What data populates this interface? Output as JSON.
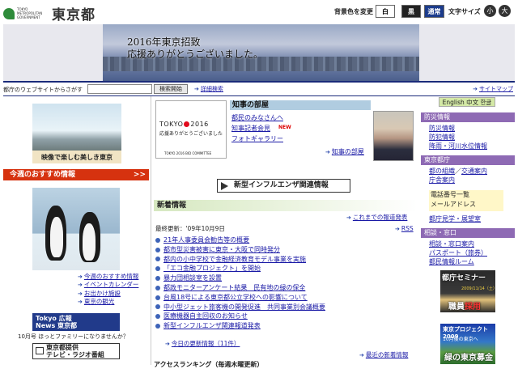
{
  "header": {
    "logo_small": "TOKYO METROPOLITAN GOVERNMENT",
    "logo_big": "東京都",
    "bg_color_label": "背景色を変更",
    "bg_white": "白",
    "bg_black": "黒",
    "bg_normal": "通常",
    "font_size_label": "文字サイズ",
    "font_small": "小",
    "font_large": "大"
  },
  "banner": {
    "line1": "2016年東京招致",
    "line2": "応援ありがとうございました。"
  },
  "search": {
    "label": "都庁のウェブサイトからさがす",
    "placeholder": "",
    "button": "検索開始",
    "advanced": "詳細検索",
    "sitemap": "サイトマップ"
  },
  "left": {
    "video_caption": "映像で楽しむ美しき東京",
    "recommend_title": "今週のおすすめ情報",
    "links": [
      "今週のおすすめ情報",
      "イベントカレンダー",
      "お出かけ施設",
      "東京の観光"
    ],
    "tokyo_news_line1": "Tokyo 広報",
    "tokyo_news_line2": "News 東京都",
    "tokyo_news_caption": "10月号 ほっとファミリーになりませんか？",
    "tv_radio_line1": "東京都提供",
    "tv_radio_line2": "テレビ・ラジオ番組"
  },
  "center": {
    "tokyo2016_logo_left": "TOKYO",
    "tokyo2016_logo_right": "2016",
    "tokyo2016_sub": "応援ありがとうございました",
    "tokyo2016_bid": "TOKYO 2016 BID COMMITTEE",
    "governor_title": "知事の部屋",
    "governor_links": [
      "都民のみなさんへ",
      "知事記者会見",
      "フォトギャラリー"
    ],
    "new_badge": "NEW",
    "governor_more": "知事の部屋",
    "flu_label": "新型インフルエンザ関連情報",
    "news_title": "新着情報",
    "updated": "最終更新：'09年10月9日",
    "archive": "これまでの報道発表",
    "rss": "RSS",
    "news_items": [
      "21年人事委員会勧告等の概要",
      "都市型災害被害に東京・大阪で同時発分",
      "都内の小中学校で金融経済教育モデル事業を実施",
      "「エコ金融プロジェクト」を開始",
      "暴力団相談室を設置",
      "都政モニターアンケート結果　民有地の緑の保全",
      "台風18号による東京都公立学校への影響について",
      "中小型ジェット旅客機の開発促進　共同事業別会議概要",
      "医療機器自主回収のお知らせ",
      "新型インフルエンザ関連報道発表"
    ],
    "today_updates": "今日の更新情報（11件）",
    "latest_reports": "最近の新着情報",
    "bottom_heading": "アクセスランキング（毎週木曜更新）"
  },
  "right": {
    "lang": "English 中文 한글",
    "sec1_title": "防災情報",
    "sec1_links": [
      "防災情報",
      "防犯情報",
      "降雨・河川水位情報"
    ],
    "sec2_title": "東京都庁",
    "sec2_links": [
      "都の組織",
      "交通案内",
      "庁舎案内"
    ],
    "sec2_sep": "／",
    "contact_links": [
      "電話番号一覧",
      "メールアドレス"
    ],
    "sec2_more": "都庁見学・展望室",
    "sec3_title": "相談・窓口",
    "sec3_links": [
      "相談・窓口案内",
      "パスポート（旅券）",
      "都民情報ルーム"
    ],
    "img1_title": "都庁セミナー",
    "img1_date": "2009/11/14（土）",
    "img1_sub1": "職員",
    "img1_sub2": "採用",
    "img2_title": "東京プロジェクト 2009",
    "img2_date": "10月後の東京へ",
    "img2_green": "緑の東京募金"
  }
}
